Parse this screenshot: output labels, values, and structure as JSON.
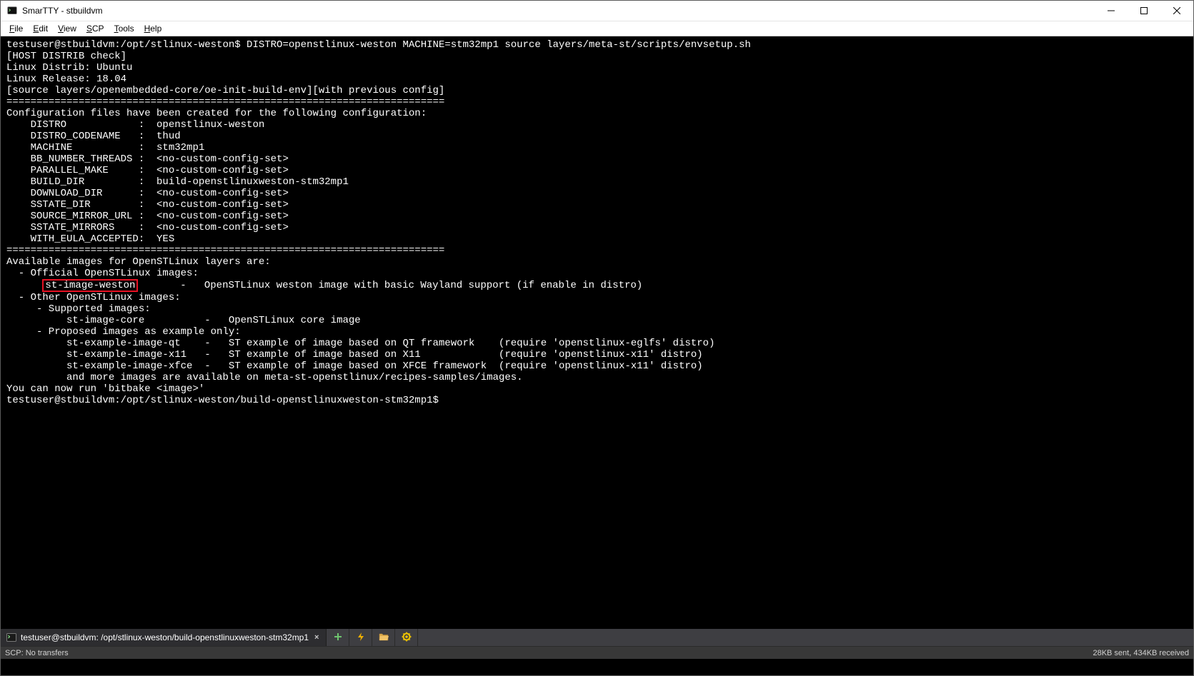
{
  "window": {
    "title": "SmarTTY - stbuildvm"
  },
  "menu": {
    "file": {
      "label": "File",
      "accel": "F"
    },
    "edit": {
      "label": "Edit",
      "accel": "E"
    },
    "view": {
      "label": "View",
      "accel": "V"
    },
    "scp": {
      "label": "SCP",
      "accel": "S"
    },
    "tools": {
      "label": "Tools",
      "accel": "T"
    },
    "help": {
      "label": "Help",
      "accel": "H"
    }
  },
  "terminal": {
    "prompt1": "testuser@stbuildvm:/opt/stlinux-weston$ ",
    "command": "DISTRO=openstlinux-weston MACHINE=stm32mp1 source layers/meta-st/scripts/envsetup.sh",
    "lines_before": [
      "[HOST DISTRIB check]",
      "Linux Distrib: Ubuntu",
      "Linux Release: 18.04",
      "",
      "[source layers/openembedded-core/oe-init-build-env][with previous config]",
      "",
      "=========================================================================",
      "Configuration files have been created for the following configuration:",
      "",
      "    DISTRO            :  openstlinux-weston",
      "    DISTRO_CODENAME   :  thud",
      "    MACHINE           :  stm32mp1",
      "    BB_NUMBER_THREADS :  <no-custom-config-set>",
      "    PARALLEL_MAKE     :  <no-custom-config-set>",
      "",
      "    BUILD_DIR         :  build-openstlinuxweston-stm32mp1",
      "    DOWNLOAD_DIR      :  <no-custom-config-set>",
      "    SSTATE_DIR        :  <no-custom-config-set>",
      "",
      "    SOURCE_MIRROR_URL :  <no-custom-config-set>",
      "    SSTATE_MIRRORS    :  <no-custom-config-set>",
      "",
      "    WITH_EULA_ACCEPTED:  YES",
      "",
      "=========================================================================",
      "",
      "Available images for OpenSTLinux layers are:",
      "",
      "  - Official OpenSTLinux images:"
    ],
    "highlight_pad": "      ",
    "highlight_text": "st-image-weston",
    "highlight_tail": "       -   OpenSTLinux weston image with basic Wayland support (if enable in distro)",
    "lines_after": [
      "",
      "  - Other OpenSTLinux images:",
      "     - Supported images:",
      "          st-image-core          -   OpenSTLinux core image",
      "     - Proposed images as example only:",
      "          st-example-image-qt    -   ST example of image based on QT framework    (require 'openstlinux-eglfs' distro)",
      "          st-example-image-x11   -   ST example of image based on X11             (require 'openstlinux-x11' distro)",
      "          st-example-image-xfce  -   ST example of image based on XFCE framework  (require 'openstlinux-x11' distro)",
      "          and more images are available on meta-st-openstlinux/recipes-samples/images.",
      "",
      "You can now run 'bitbake <image>'",
      ""
    ],
    "prompt2": "testuser@stbuildvm:/opt/stlinux-weston/build-openstlinuxweston-stm32mp1$ "
  },
  "tab": {
    "label": "testuser@stbuildvm: /opt/stlinux-weston/build-openstlinuxweston-stm32mp1",
    "close": "×"
  },
  "status": {
    "left": "SCP: No transfers",
    "right": "28KB sent, 434KB received"
  },
  "icons": {
    "plus": "new-tab-icon",
    "bolt": "quick-command-icon",
    "folder": "open-folder-icon",
    "gear": "settings-icon"
  }
}
